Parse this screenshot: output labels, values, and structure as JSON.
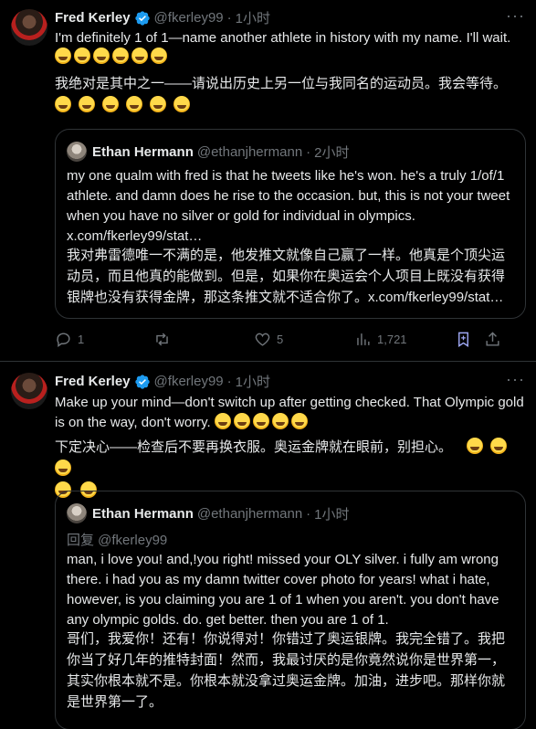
{
  "tweet1": {
    "author_name": "Fred Kerley",
    "handle": "@fkerley99",
    "time": "1小时",
    "text_en": "I'm definitely 1 of 1—name another athlete in history with my name. I'll wait.",
    "text_zh": "我绝对是其中之一——请说出历史上另一位与我同名的运动员。我会等待。",
    "quote": {
      "author_name": "Ethan Hermann",
      "handle": "@ethanjhermann",
      "time": "2小时",
      "text_en": "my one qualm with fred is that he tweets like he's won. he's a truly 1/of/1 athlete. and damn does he rise to the occasion. but, this is not your tweet when you have no silver or gold for individual in olympics. x.com/fkerley99/stat…",
      "text_zh": "我对弗雷德唯一不满的是，他发推文就像自己赢了一样。他真是个顶尖运动员，而且他真的能做到。但是，如果你在奥运会个人项目上既没有获得银牌也没有获得金牌，那这条推文就不适合你了。x.com/fkerley99/stat…"
    },
    "replies": "1",
    "retweets": "",
    "likes": "5",
    "views": "1,721"
  },
  "tweet2": {
    "author_name": "Fred Kerley",
    "handle": "@fkerley99",
    "time": "1小时",
    "text_en": "Make up your mind—don't switch up after getting checked. That Olympic gold is on the way, don't worry.",
    "text_zh": "下定决心——检查后不要再换衣服。奥运金牌就在眼前，别担心。",
    "quote": {
      "author_name": "Ethan Hermann",
      "handle": "@ethanjhermann",
      "time": "1小时",
      "reply_to": "回复 @fkerley99",
      "text_en": "man, i love you! and,!you right! missed your OLY silver. i fully am wrong there. i had you as my damn twitter cover photo for years! what i hate, however, is you claiming you are 1 of 1 when you aren't. you don't have any olympic golds. do. get better. then you are 1 of 1.",
      "text_zh": "哥们，我爱你！还有！你说得对！你错过了奥运银牌。我完全错了。我把你当了好几年的推特封面！然而，我最讨厌的是你竟然说你是世界第一，其实你根本就不是。你根本就没拿过奥运金牌。加油，进步吧。那样你就是世界第一了。"
    }
  },
  "colors": {
    "background": "#000000",
    "text": "#e7e9ea",
    "muted": "#71767b",
    "border": "#2f3336",
    "verified": "#1d9bf0",
    "bookmark": "#9fa8f5"
  }
}
